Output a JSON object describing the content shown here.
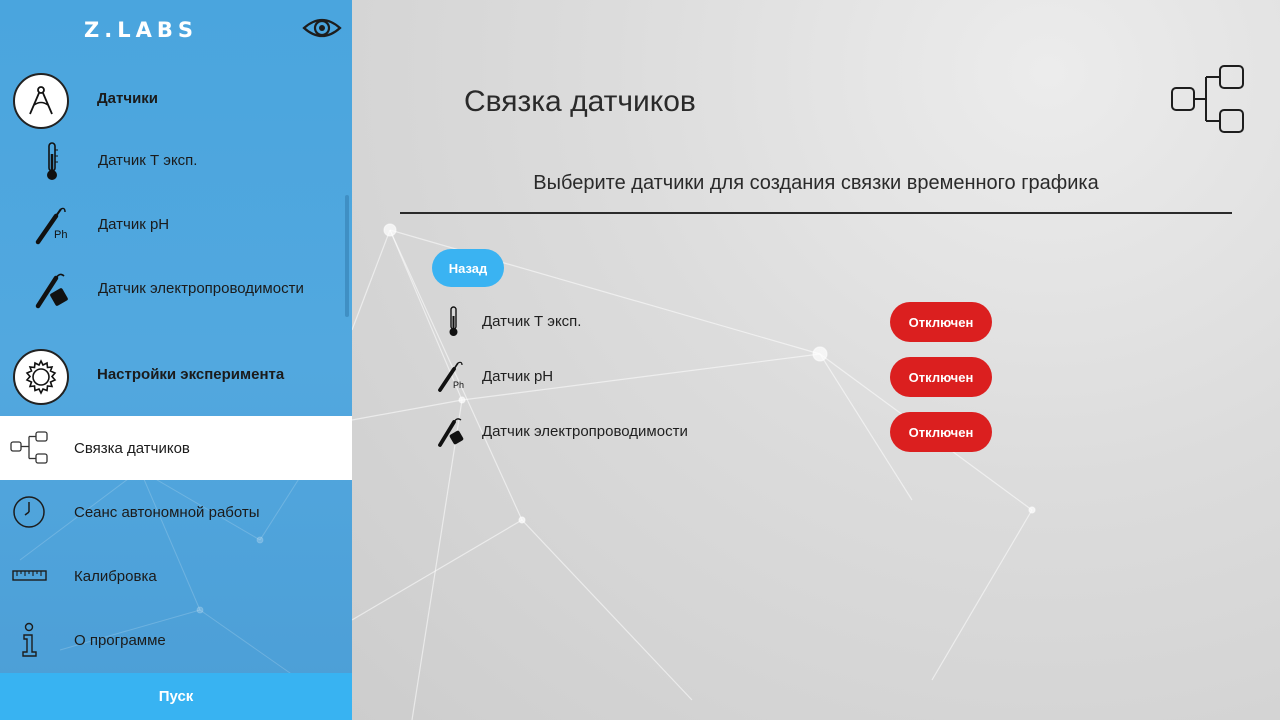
{
  "app": {
    "brand": "Z.LABS"
  },
  "sidebar": {
    "sensors_section": {
      "label": "Датчики"
    },
    "sensors": [
      {
        "label": "Датчик Т эксп.",
        "icon": "thermometer-icon"
      },
      {
        "label": "Датчик pH",
        "icon": "ph-probe-icon"
      },
      {
        "label": "Датчик электропроводимости",
        "icon": "conductivity-probe-icon"
      }
    ],
    "settings_section": {
      "label": "Настройки эксперимента"
    },
    "nav": [
      {
        "label": "Связка датчиков",
        "icon": "sensor-link-icon",
        "active": true
      },
      {
        "label": "Сеанс автономной работы",
        "icon": "clock-icon"
      },
      {
        "label": "Калибровка",
        "icon": "ruler-icon"
      },
      {
        "label": "О программе",
        "icon": "info-icon"
      }
    ],
    "start_label": "Пуск"
  },
  "main": {
    "title": "Связка датчиков",
    "subtitle": "Выберите датчики для создания связки временного графика",
    "back_label": "Назад",
    "rows": [
      {
        "label": "Датчик Т эксп.",
        "status": "Отключен",
        "icon": "thermometer-icon"
      },
      {
        "label": "Датчик pH",
        "status": "Отключен",
        "icon": "ph-probe-icon"
      },
      {
        "label": "Датчик электропроводимости",
        "status": "Отключен",
        "icon": "conductivity-probe-icon"
      }
    ]
  },
  "colors": {
    "sidebar": "#4fa7de",
    "accent": "#38b3f2",
    "status_off": "#db1f1f",
    "text": "#1b1b1b"
  }
}
